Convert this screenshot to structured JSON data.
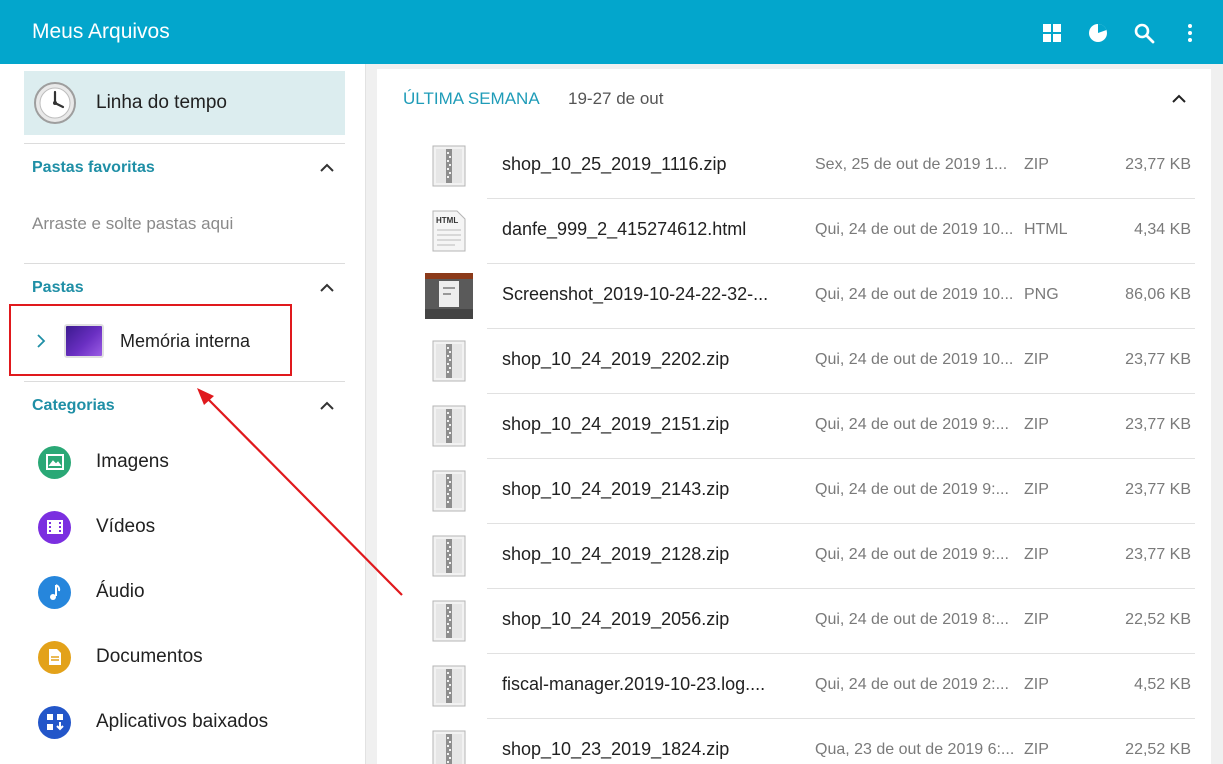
{
  "app": {
    "title": "Meus Arquivos"
  },
  "toolbar": {
    "icons": [
      "grid-view-icon",
      "storage-analysis-icon",
      "search-icon",
      "more-options-icon"
    ]
  },
  "sidebar": {
    "timeline_label": "Linha do tempo",
    "favorites": {
      "title": "Pastas favoritas",
      "hint": "Arraste e solte pastas aqui"
    },
    "folders": {
      "title": "Pastas",
      "storage_label": "Memória interna"
    },
    "categories": {
      "title": "Categorias",
      "items": [
        {
          "label": "Imagens",
          "icon": "images-icon",
          "color": "#2aa876"
        },
        {
          "label": "Vídeos",
          "icon": "videos-icon",
          "color": "#7b2fe0"
        },
        {
          "label": "Áudio",
          "icon": "audio-icon",
          "color": "#2686dc"
        },
        {
          "label": "Documentos",
          "icon": "documents-icon",
          "color": "#e3a21a"
        },
        {
          "label": "Aplicativos baixados",
          "icon": "downloaded-apps-icon",
          "color": "#2356c9"
        }
      ]
    }
  },
  "main": {
    "group_title": "ÚLTIMA SEMANA",
    "group_range": "19-27 de out",
    "files": [
      {
        "name": "shop_10_25_2019_1116.zip",
        "date": "Sex, 25 de out de 2019 1...",
        "type": "ZIP",
        "size": "23,77 KB",
        "icon": "zip-file-icon"
      },
      {
        "name": "danfe_999_2_415274612.html",
        "date": "Qui, 24 de out de 2019 10...",
        "type": "HTML",
        "size": "4,34 KB",
        "icon": "html-file-icon"
      },
      {
        "name": "Screenshot_2019-10-24-22-32-...",
        "date": "Qui, 24 de out de 2019 10...",
        "type": "PNG",
        "size": "86,06 KB",
        "icon": "image-thumbnail-icon"
      },
      {
        "name": "shop_10_24_2019_2202.zip",
        "date": "Qui, 24 de out de 2019 10...",
        "type": "ZIP",
        "size": "23,77 KB",
        "icon": "zip-file-icon"
      },
      {
        "name": "shop_10_24_2019_2151.zip",
        "date": "Qui, 24 de out de 2019 9:...",
        "type": "ZIP",
        "size": "23,77 KB",
        "icon": "zip-file-icon"
      },
      {
        "name": "shop_10_24_2019_2143.zip",
        "date": "Qui, 24 de out de 2019 9:...",
        "type": "ZIP",
        "size": "23,77 KB",
        "icon": "zip-file-icon"
      },
      {
        "name": "shop_10_24_2019_2128.zip",
        "date": "Qui, 24 de out de 2019 9:...",
        "type": "ZIP",
        "size": "23,77 KB",
        "icon": "zip-file-icon"
      },
      {
        "name": "shop_10_24_2019_2056.zip",
        "date": "Qui, 24 de out de 2019 8:...",
        "type": "ZIP",
        "size": "22,52 KB",
        "icon": "zip-file-icon"
      },
      {
        "name": "fiscal-manager.2019-10-23.log....",
        "date": "Qui, 24 de out de 2019 2:...",
        "type": "ZIP",
        "size": "4,52 KB",
        "icon": "zip-file-icon"
      },
      {
        "name": "shop_10_23_2019_1824.zip",
        "date": "Qua, 23 de out de 2019 6:...",
        "type": "ZIP",
        "size": "22,52 KB",
        "icon": "zip-file-icon"
      }
    ]
  },
  "colors": {
    "appbar": "#03a6cc",
    "accent_text": "#1f8fa6",
    "highlight": "#e0191d"
  }
}
